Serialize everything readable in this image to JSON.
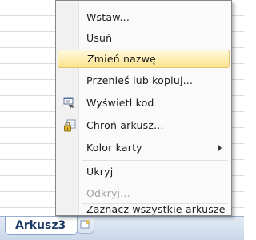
{
  "context_menu": {
    "items": [
      {
        "label": "Wstaw...",
        "state": "normal"
      },
      {
        "label": "Usuń",
        "state": "normal"
      },
      {
        "label": "Zmień nazwę",
        "state": "highlighted"
      },
      {
        "label": "Przenieś lub kopiuj...",
        "state": "normal"
      },
      {
        "label": "Wyświetl kod",
        "state": "normal",
        "icon": "view-code-icon"
      },
      {
        "label": "Chroń arkusz...",
        "state": "normal",
        "icon": "protect-sheet-icon"
      },
      {
        "label": "Kolor karty",
        "state": "normal",
        "submenu": true
      },
      {
        "label": "Ukryj",
        "state": "normal"
      },
      {
        "label": "Odkryj...",
        "state": "disabled"
      },
      {
        "label": "Zaznacz wszystkie arkusze",
        "state": "normal"
      }
    ]
  },
  "sheet_tabs": {
    "active_tab": "Arkusz3",
    "insert_tab_icon": "insert-worksheet-icon"
  },
  "colors": {
    "highlight_top": "#fff8dc",
    "highlight_bottom": "#fde48f",
    "highlight_border": "#e3c46f",
    "disabled_text": "#a3a3a3",
    "tab_text": "#1f3a66"
  }
}
